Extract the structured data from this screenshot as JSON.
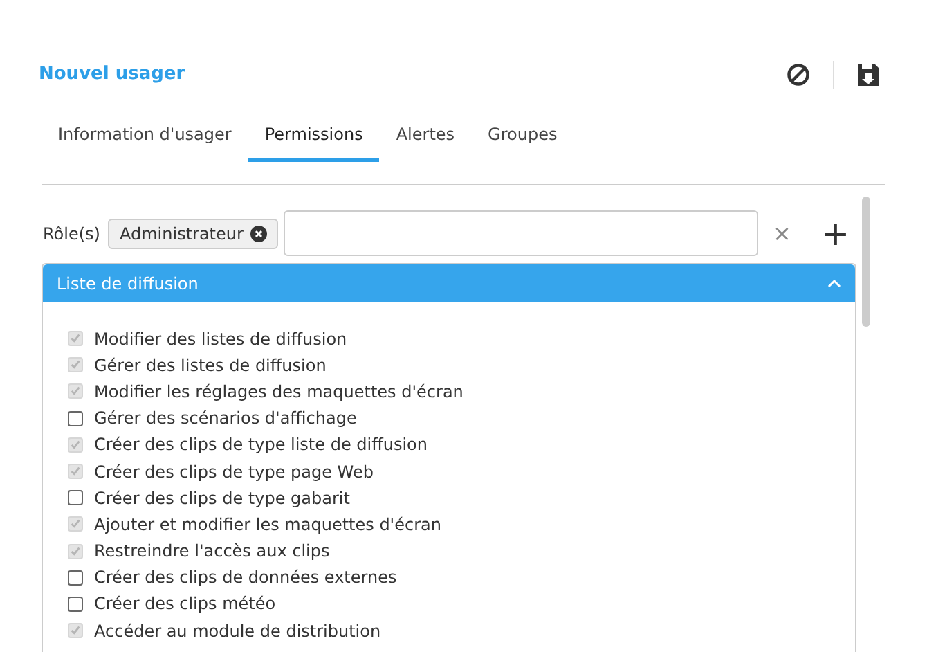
{
  "title": "Nouvel usager",
  "tabs": [
    {
      "label": "Information d'usager",
      "selected": false
    },
    {
      "label": "Permissions",
      "selected": true
    },
    {
      "label": "Alertes",
      "selected": false
    },
    {
      "label": "Groupes",
      "selected": false
    }
  ],
  "roles": {
    "label": "Rôle(s)",
    "tags": [
      "Administrateur"
    ],
    "clear": "×",
    "add": "+"
  },
  "section": {
    "title": "Liste de diffusion",
    "expanded": true,
    "permissions": [
      {
        "label": "Modifier des listes de diffusion",
        "checked": true,
        "disabled": true
      },
      {
        "label": "Gérer des listes de diffusion",
        "checked": true,
        "disabled": true
      },
      {
        "label": "Modifier les réglages des maquettes d'écran",
        "checked": true,
        "disabled": true
      },
      {
        "label": "Gérer des scénarios d'affichage",
        "checked": false,
        "disabled": false
      },
      {
        "label": "Créer des clips de type liste de diffusion",
        "checked": true,
        "disabled": true
      },
      {
        "label": "Créer des clips de type page Web",
        "checked": true,
        "disabled": true
      },
      {
        "label": "Créer des clips de type gabarit",
        "checked": false,
        "disabled": false
      },
      {
        "label": "Ajouter et modifier les maquettes d'écran",
        "checked": true,
        "disabled": true
      },
      {
        "label": "Restreindre l'accès aux clips",
        "checked": true,
        "disabled": true
      },
      {
        "label": "Créer des clips de données externes",
        "checked": false,
        "disabled": false
      },
      {
        "label": "Créer des clips météo",
        "checked": false,
        "disabled": false
      },
      {
        "label": "Accéder au module de distribution",
        "checked": true,
        "disabled": true
      }
    ]
  }
}
